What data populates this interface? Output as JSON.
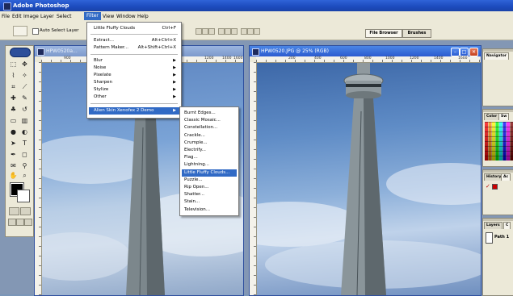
{
  "app": {
    "title": "Adobe Photoshop"
  },
  "menubar": {
    "items": [
      {
        "label": "File"
      },
      {
        "label": "Edit"
      },
      {
        "label": "Image"
      },
      {
        "label": "Layer"
      },
      {
        "label": "Select"
      },
      {
        "label": "Filter"
      },
      {
        "label": "View"
      },
      {
        "label": "Window"
      },
      {
        "label": "Help"
      }
    ]
  },
  "options_bar": {
    "auto_select_label": "Auto Select Layer",
    "file_browser_tab": "File Browser",
    "brushes_tab": "Brushes"
  },
  "filter_menu": {
    "last_filter": {
      "label": "Little Fluffy Clouds",
      "shortcut": "Ctrl+F"
    },
    "extract": {
      "label": "Extract...",
      "shortcut": "Alt+Ctrl+X"
    },
    "pattern_maker": {
      "label": "Pattern Maker...",
      "shortcut": "Alt+Shift+Ctrl+X"
    },
    "submenus": [
      {
        "label": "Blur"
      },
      {
        "label": "Noise"
      },
      {
        "label": "Pixelate"
      },
      {
        "label": "Sharpen"
      },
      {
        "label": "Stylize"
      },
      {
        "label": "Other"
      }
    ],
    "plugin": {
      "label": "Alien Skin Xenofex 2 Demo"
    }
  },
  "xenofex_submenu": {
    "items": [
      "Burnt Edges...",
      "Classic Mosaic...",
      "Constellation...",
      "Crackle...",
      "Crumple...",
      "Electrify...",
      "Flag...",
      "Lightning...",
      "Little Fluffy Clouds...",
      "Puzzle...",
      "Rip Open...",
      "Shatter...",
      "Stain...",
      "Television..."
    ],
    "highlighted_index": 8
  },
  "documents": [
    {
      "title": "HPW0520a...",
      "active": false
    },
    {
      "title": "HPW0520.JPG @ 25% (RGB)",
      "active": true
    }
  ],
  "rulers": {
    "left_doc": [
      "900",
      "1200",
      "1400",
      "1600"
    ],
    "right_doc": [
      "200",
      "400",
      "600",
      "800",
      "1000",
      "1200",
      "1400",
      "1600"
    ]
  },
  "palettes": {
    "navigator_tab": "Navigator",
    "color_tab": "Color",
    "swatches_tab": "Sw",
    "history_tab": "History",
    "actions_tab": "Ac",
    "layers_tab": "Layers",
    "paths_tab": "C",
    "path_item": "Path 1"
  },
  "colors": {
    "xp_blue": "#2c5bd0",
    "menu_highlight": "#316ac5",
    "chrome": "#ece9d8"
  }
}
